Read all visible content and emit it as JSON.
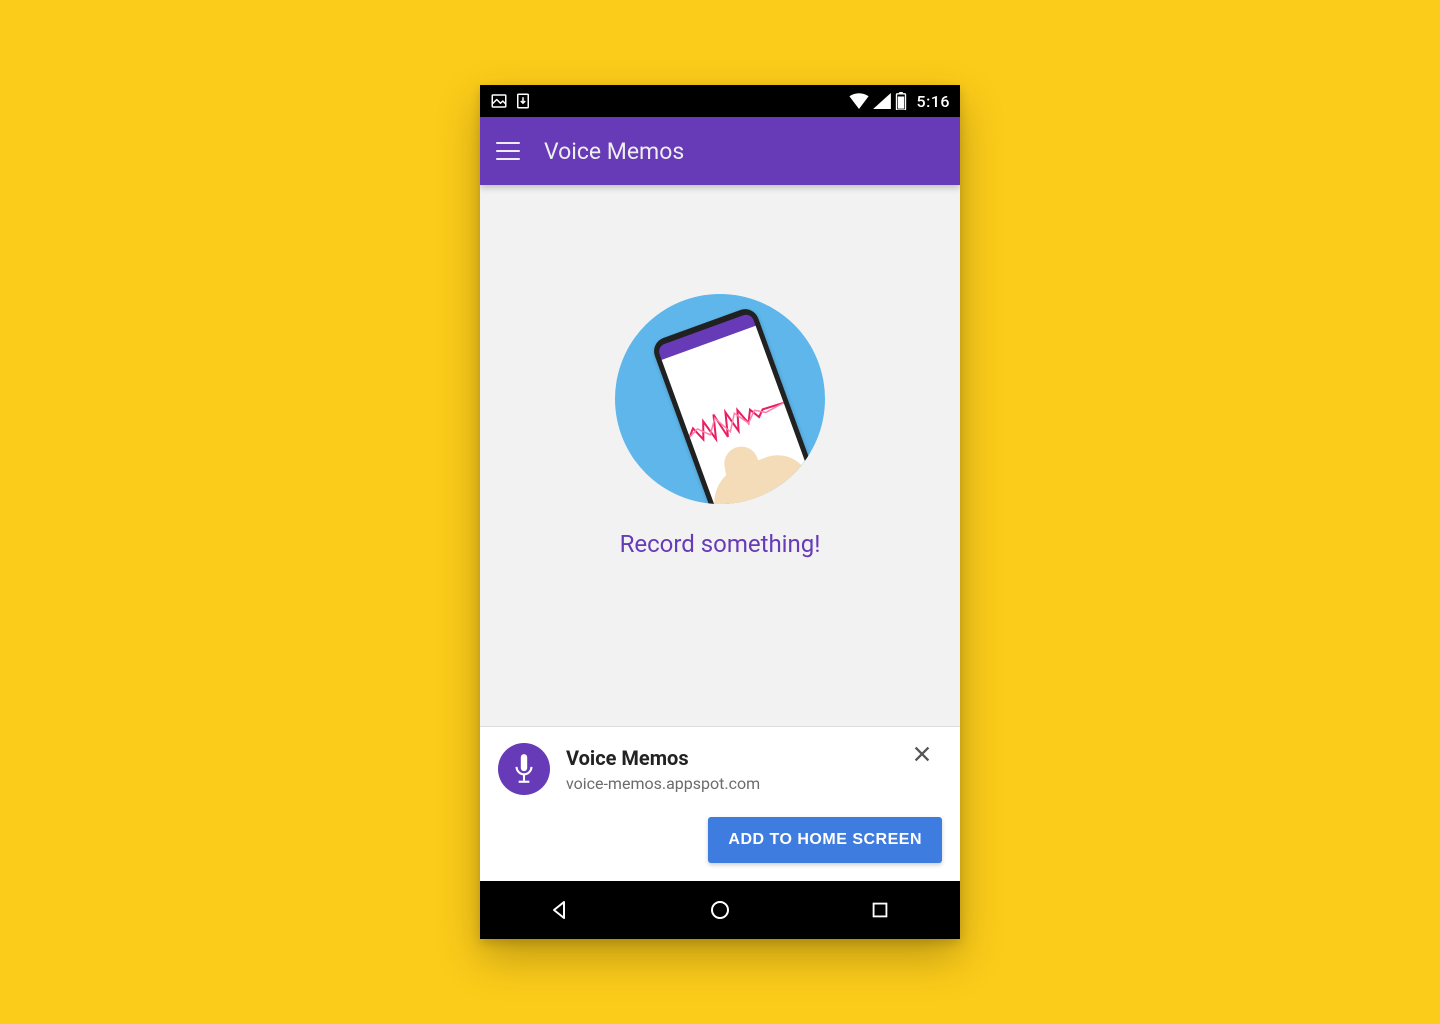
{
  "statusbar": {
    "clock": "5:16",
    "icons_left": [
      "image-notification-icon",
      "download-notification-icon"
    ],
    "icons_right": [
      "wifi-icon",
      "cell-signal-icon",
      "battery-icon"
    ]
  },
  "appbar": {
    "title": "Voice Memos"
  },
  "content": {
    "cta": "Record something!"
  },
  "install_prompt": {
    "name": "Voice Memos",
    "host": "voice-memos.appspot.com",
    "action_label": "ADD TO HOME SCREEN"
  },
  "colors": {
    "accent": "#673AB7",
    "background": "#fccc1a",
    "button": "#3f7ce0"
  }
}
